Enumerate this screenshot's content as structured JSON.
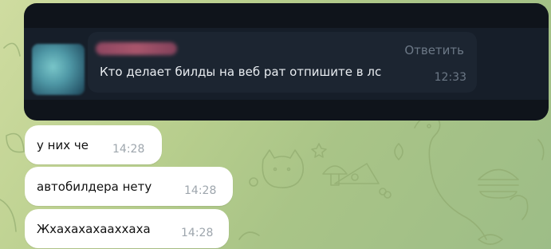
{
  "colors": {
    "wallpaper_start": "#cfdca0",
    "wallpaper_end": "#9dbd87",
    "screenshot_background": "#0f141b",
    "quote_bubble": "#1c2531",
    "bubble": "#ffffff",
    "timestamp": "#9ea6ad"
  },
  "screenshot": {
    "reply_label": "Ответить",
    "quoted_message": "Кто делает билды на веб рат отпишите в лс",
    "quoted_time": "12:33",
    "avatar_icon": "blurred-avatar",
    "sender_name_icon": "blurred-name"
  },
  "messages": [
    {
      "text": "у них че",
      "time": "14:28"
    },
    {
      "text": "автобилдера нету",
      "time": "14:28"
    },
    {
      "text": "Жхахахахааххаха",
      "time": "14:28"
    }
  ]
}
